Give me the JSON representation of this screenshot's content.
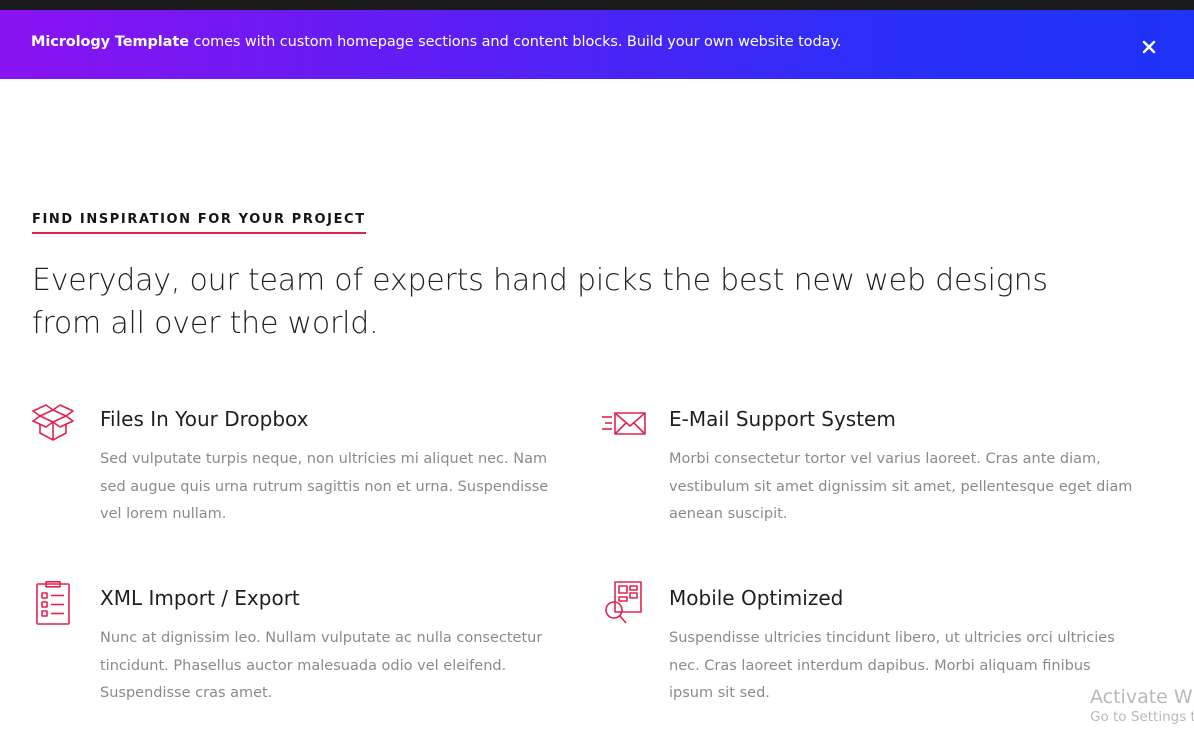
{
  "banner": {
    "brand": "Micrology Template",
    "message": " comes with custom homepage sections and content blocks. Build your own website today.",
    "close_icon": "close-icon"
  },
  "section": {
    "eyebrow": "FIND INSPIRATION FOR YOUR PROJECT",
    "headline": "Everyday, our team of experts hand picks the best new web designs from all over the world."
  },
  "features": [
    {
      "icon": "box-icon",
      "title": "Files In Your Dropbox",
      "description": "Sed vulputate turpis neque, non ultricies mi aliquet nec. Nam sed augue quis urna rutrum sagittis non et urna. Suspendisse vel lorem nullam."
    },
    {
      "icon": "email-icon",
      "title": "E-Mail Support System",
      "description": "Morbi consectetur tortor vel varius laoreet. Cras ante diam, vestibulum sit amet dignissim sit amet, pellentesque eget diam aenean suscipit."
    },
    {
      "icon": "clipboard-icon",
      "title": "XML Import / Export",
      "description": "Nunc at dignissim leo. Nullam vulputate ac nulla consectetur tincidunt. Phasellus auctor malesuada odio vel eleifend. Suspendisse cras amet."
    },
    {
      "icon": "search-layout-icon",
      "title": "Mobile Optimized",
      "description": "Suspendisse ultricies tincidunt libero, ut ultricies orci ultricies nec. Cras laoreet interdum dapibus. Morbi aliquam finibus ipsum sit sed."
    }
  ],
  "watermark": {
    "line1": "Activate Wir",
    "line2": "Go to Settings t"
  },
  "colors": {
    "accent": "#e0224f",
    "banner_start": "#8a13f2",
    "banner_end": "#1f33f8"
  }
}
